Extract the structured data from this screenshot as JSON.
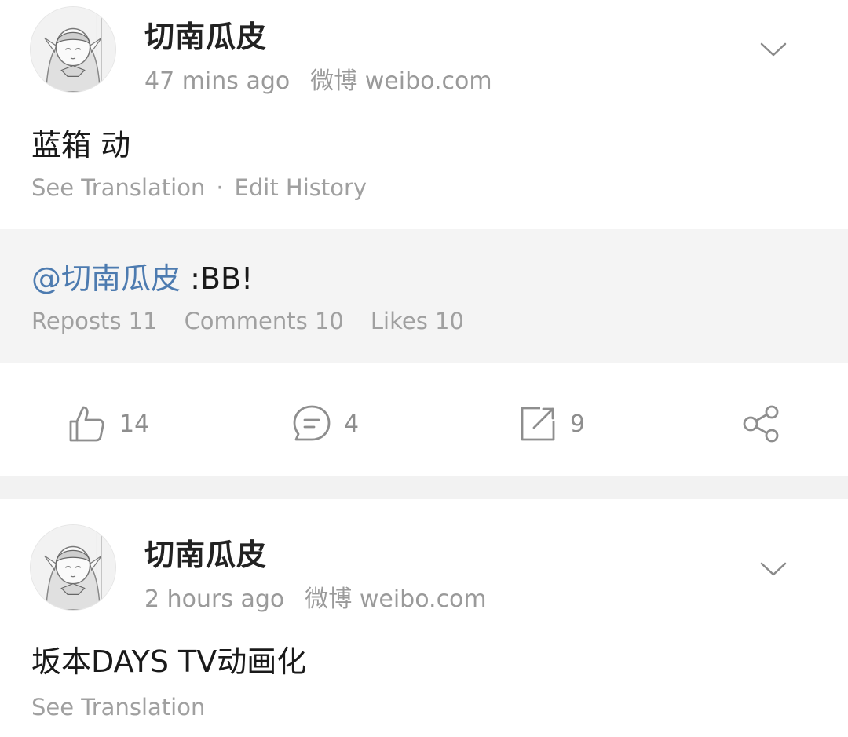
{
  "posts": [
    {
      "author": "切南瓜皮",
      "time": "47  mins ago",
      "source": "微博 weibo.com",
      "content": "蓝箱 动",
      "see_translation": "See Translation",
      "separator": "·",
      "edit_history": "Edit History",
      "repost": {
        "mention": "@切南瓜皮",
        "text": " :BB!",
        "reposts": "Reposts 11",
        "comments": "Comments 10",
        "likes": "Likes 10"
      },
      "actions": {
        "likes": "14",
        "comments": "4",
        "reposts": "9"
      }
    },
    {
      "author": "切南瓜皮",
      "time": "2 hours ago",
      "source": "微博 weibo.com",
      "content": "坂本DAYS TV动画化",
      "see_translation": "See Translation"
    }
  ],
  "colors": {
    "mention": "#4d7bb0",
    "muted_text": "#a0a0a0",
    "repost_bg": "#f4f4f4",
    "divider": "#f2f2f2"
  },
  "icons": [
    "chevron-down-icon",
    "thumbs-up-icon",
    "comment-icon",
    "repost-icon",
    "share-icon"
  ]
}
